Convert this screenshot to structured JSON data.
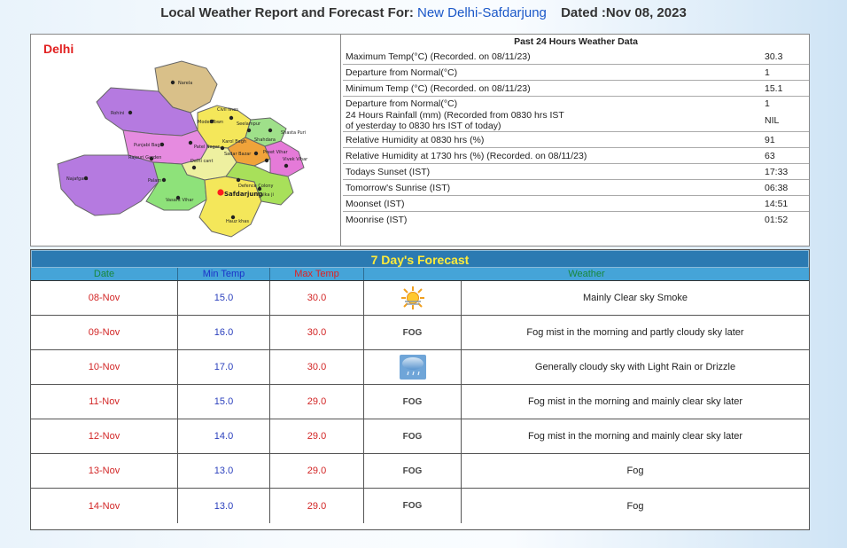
{
  "header": {
    "prefix": "Local Weather Report and Forecast For:",
    "location": "New Delhi-Safdarjung",
    "dated": "Dated :Nov 08, 2023"
  },
  "map": {
    "title": "Delhi",
    "labels": [
      "Narela",
      "Rohini",
      "Model Town",
      "Civil lines",
      "Seelampur",
      "Shahdara",
      "Punjabi Bagh",
      "Patel Nagar",
      "Karol Bagh",
      "Preet Vihar",
      "Rajouri Garden",
      "Delhi cant",
      "Kalka ji",
      "Najafgarh",
      "Palam",
      "Vasant Vihar",
      "Safdarjung",
      "Hauz khas",
      "Defence Colony",
      "Shasta Puri",
      "Vivek Vihar",
      "Sadar Bazar"
    ]
  },
  "past24": {
    "heading": "Past 24 Hours Weather Data",
    "rows": [
      {
        "label": "Maximum Temp(°C) (Recorded. on 08/11/23)",
        "value": "30.3"
      },
      {
        "label": "Departure from Normal(°C)",
        "value": "1"
      },
      {
        "label": "Minimum Temp (°C) (Recorded. on 08/11/23)",
        "value": "15.1"
      },
      {
        "label": "Departure from Normal(°C)",
        "value": "1"
      },
      {
        "label": "24 Hours Rainfall (mm) (Recorded from 0830 hrs IST",
        "label2": "of yesterday to 0830 hrs IST of today)",
        "value": "NIL"
      },
      {
        "label": "Relative Humidity at 0830 hrs (%)",
        "value": "91"
      },
      {
        "label": "Relative Humidity at 1730 hrs (%) (Recorded. on 08/11/23)",
        "value": "63"
      },
      {
        "label": "Todays Sunset (IST)",
        "value": "17:33"
      },
      {
        "label": "Tomorrow's Sunrise (IST)",
        "value": "06:38"
      },
      {
        "label": "Moonset (IST)",
        "value": "14:51"
      },
      {
        "label": "Moonrise (IST)",
        "value": "01:52"
      }
    ]
  },
  "forecast": {
    "title": "7 Day's Forecast",
    "columns": {
      "date": "Date",
      "min": "Min Temp",
      "max": "Max Temp",
      "weather": "Weather"
    },
    "rows": [
      {
        "date": "08-Nov",
        "min": "15.0",
        "max": "30.0",
        "icon": "sun-haze-icon",
        "icon_text": "",
        "weather": "Mainly Clear sky Smoke"
      },
      {
        "date": "09-Nov",
        "min": "16.0",
        "max": "30.0",
        "icon": "fog-icon",
        "icon_text": "FOG",
        "weather": "Fog mist in the morning and partly cloudy sky later"
      },
      {
        "date": "10-Nov",
        "min": "17.0",
        "max": "30.0",
        "icon": "rain-cloud-icon",
        "icon_text": "",
        "weather": "Generally cloudy sky with Light Rain or Drizzle"
      },
      {
        "date": "11-Nov",
        "min": "15.0",
        "max": "29.0",
        "icon": "fog-icon",
        "icon_text": "FOG",
        "weather": "Fog mist in the morning and mainly clear sky later"
      },
      {
        "date": "12-Nov",
        "min": "14.0",
        "max": "29.0",
        "icon": "fog-icon",
        "icon_text": "FOG",
        "weather": "Fog mist in the morning and mainly clear sky later"
      },
      {
        "date": "13-Nov",
        "min": "13.0",
        "max": "29.0",
        "icon": "fog-icon",
        "icon_text": "FOG",
        "weather": "Fog"
      },
      {
        "date": "14-Nov",
        "min": "13.0",
        "max": "29.0",
        "icon": "fog-icon",
        "icon_text": "FOG",
        "weather": "Fog"
      }
    ]
  }
}
